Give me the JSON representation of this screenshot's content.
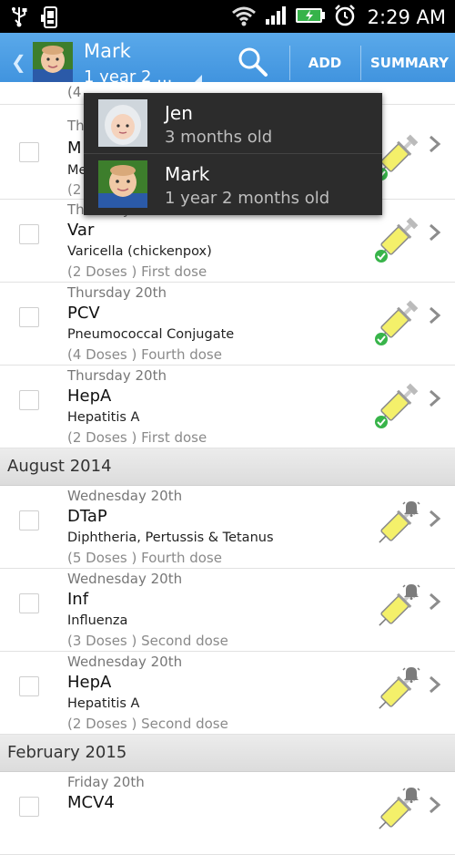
{
  "status_bar": {
    "time": "2:29 AM",
    "icons": [
      "usb-icon",
      "android-debug-icon",
      "wifi-icon",
      "signal-icon",
      "battery-charging-icon",
      "alarm-icon"
    ]
  },
  "action_bar": {
    "profile_name": "Mark",
    "profile_age": "1 year 2 ...",
    "add_label": "ADD",
    "summary_label": "SUMMARY",
    "accent_color": "#3b8fdc"
  },
  "dropdown": {
    "items": [
      {
        "name": "Jen",
        "age": "3 months old"
      },
      {
        "name": "Mark",
        "age": "1 year 2 months old"
      }
    ]
  },
  "list": {
    "partial_row": {
      "doses": "(4",
      "date": "Th",
      "abbr": "M",
      "full": "Me",
      "doses2": "(2"
    },
    "var_row": {
      "date": "Thursday 20th",
      "abbr": "Var",
      "full": "Varicella (chickenpox)",
      "doses": "(2 Doses ) First dose"
    },
    "pcv_row": {
      "date": "Thursday 20th",
      "abbr": "PCV",
      "full": "Pneumococcal Conjugate",
      "doses": "(4 Doses ) Fourth dose"
    },
    "hepa1_row": {
      "date": "Thursday 20th",
      "abbr": "HepA",
      "full": "Hepatitis A",
      "doses": "(2 Doses ) First dose"
    },
    "section_aug": "August 2014",
    "dtap_row": {
      "date": "Wednesday 20th",
      "abbr": "DTaP",
      "full": "Diphtheria, Pertussis & Tetanus",
      "doses": "(5 Doses ) Fourth dose"
    },
    "inf_row": {
      "date": "Wednesday 20th",
      "abbr": "Inf",
      "full": "Influenza",
      "doses": "(3 Doses ) Second dose"
    },
    "hepa2_row": {
      "date": "Wednesday 20th",
      "abbr": "HepA",
      "full": "Hepatitis A",
      "doses": "(2 Doses ) Second dose"
    },
    "section_feb": "February 2015",
    "mcv4_row": {
      "date": "Friday 20th",
      "abbr": "MCV4"
    }
  }
}
